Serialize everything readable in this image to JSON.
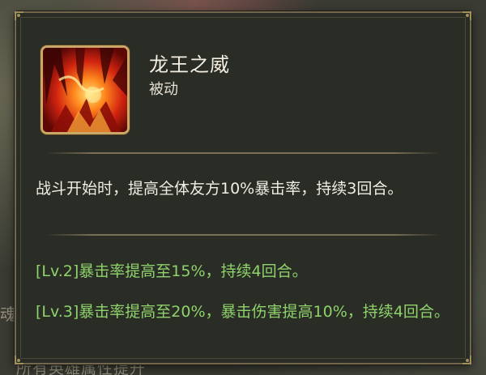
{
  "skill": {
    "name": "龙王之威",
    "type": "被动",
    "icon": "dragon-king-flame-icon",
    "description": "战斗开始时，提高全体友方10%暴击率，持续3回合。"
  },
  "levels": [
    {
      "text": "[Lv.2]暴击率提高至15%，持续4回合。"
    },
    {
      "text": "[Lv.3]暴击率提高至20%，暴击伤害提高10%，持续4回合。"
    }
  ],
  "background": {
    "left_partial": "魂",
    "bottom_partial": "所有英雄属性提升"
  },
  "colors": {
    "panel": "#2a2c26",
    "border": "#72664c",
    "icon_frame": "#c9a867",
    "title": "#f3efe2",
    "level_text": "#8ed36b"
  }
}
